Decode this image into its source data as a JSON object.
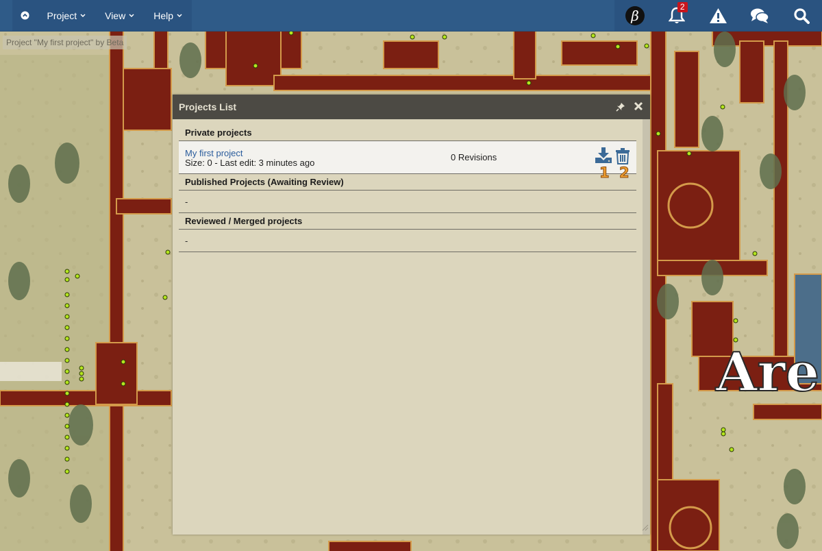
{
  "nav": {
    "menu": [
      "Project",
      "View",
      "Help"
    ],
    "notification_count": "2"
  },
  "map": {
    "project_label": "Project \"My first project\" by Beta",
    "area_text": "Are"
  },
  "dialog": {
    "title": "Projects List",
    "sections": {
      "private": "Private projects",
      "published": "Published Projects (Awaiting Review)",
      "reviewed": "Reviewed / Merged projects"
    },
    "project": {
      "name": "My first project",
      "meta": "Size: 0 - Last edit: 3 minutes ago",
      "revisions": "0 Revisions"
    },
    "empty_marker": "-",
    "annotations": [
      "1",
      "2"
    ]
  },
  "colors": {
    "nav_bg": "#2f5b88",
    "dialog_bg": "#dcd6bd",
    "dialog_header": "#4c4a44",
    "link": "#2a5c9c",
    "annotation": "#f0a030"
  }
}
